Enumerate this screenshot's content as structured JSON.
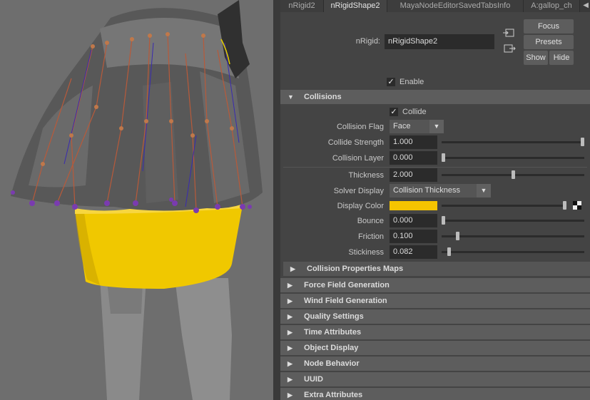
{
  "tabs": [
    "nRigid2",
    "nRigidShape2",
    "MayaNodeEditorSavedTabsInfo",
    "A:gallop_ch"
  ],
  "tab_scroll_icon": "triangle-left-icon",
  "header": {
    "nrigid_label": "nRigid:",
    "nrigid_value": "nRigidShape2",
    "focus": "Focus",
    "presets": "Presets",
    "show": "Show",
    "hide": "Hide"
  },
  "enable_label": "Enable",
  "collisions": {
    "title": "Collisions",
    "collide_label": "Collide",
    "collision_flag": {
      "label": "Collision Flag",
      "value": "Face"
    },
    "collide_strength": {
      "label": "Collide Strength",
      "value": "1.000",
      "level": 1.0
    },
    "collision_layer": {
      "label": "Collision Layer",
      "value": "0.000",
      "level": 0.0
    },
    "thickness": {
      "label": "Thickness",
      "value": "2.000",
      "level": 0.5
    },
    "solver_display": {
      "label": "Solver Display",
      "value": "Collision Thickness"
    },
    "display_color": {
      "label": "Display Color",
      "color": "#f5c400",
      "level": 1.0
    },
    "bounce": {
      "label": "Bounce",
      "value": "0.000",
      "level": 0.0
    },
    "friction": {
      "label": "Friction",
      "value": "0.100",
      "level": 0.1
    },
    "stickiness": {
      "label": "Stickiness",
      "value": "0.082",
      "level": 0.04
    },
    "properties_maps": "Collision Properties Maps"
  },
  "sections": [
    "Force Field Generation",
    "Wind Field Generation",
    "Quality Settings",
    "Time Attributes",
    "Object Display",
    "Node Behavior",
    "UUID",
    "Extra Attributes"
  ],
  "colors": {
    "skirt_yellow": "#f0c800",
    "viewport_bg": "#6e6e6e",
    "panel_bg": "#444444"
  }
}
